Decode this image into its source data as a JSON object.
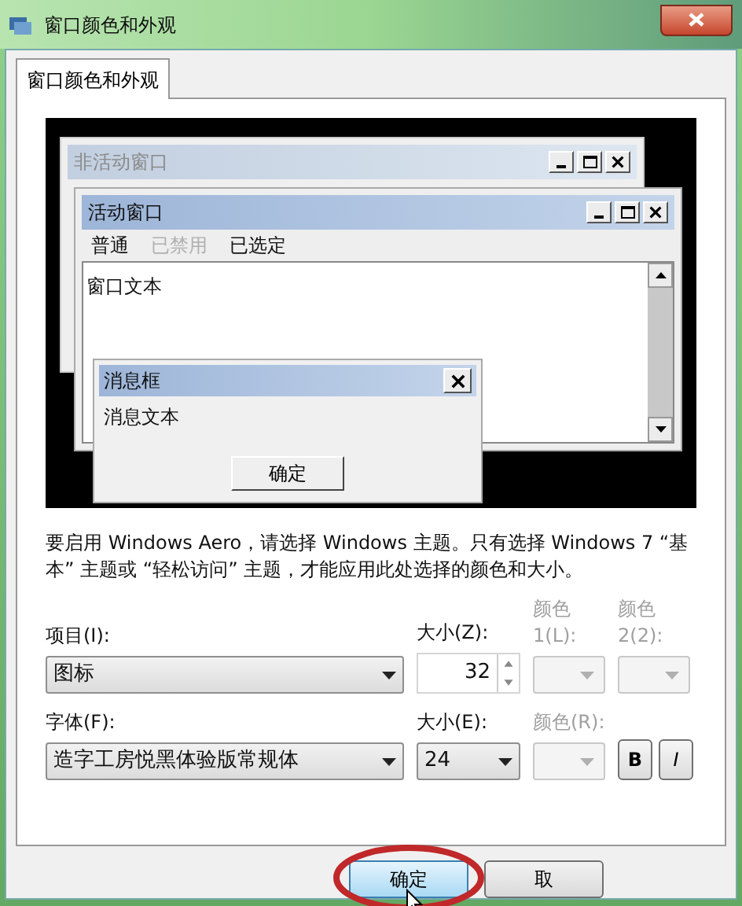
{
  "window": {
    "title": "窗口颜色和外观"
  },
  "tabs": [
    {
      "label": "窗口颜色和外观",
      "selected": true
    }
  ],
  "preview": {
    "inactive_window": {
      "title": "非活动窗口"
    },
    "active_window": {
      "title": "活动窗口",
      "menu": [
        {
          "label": "普通",
          "disabled": false
        },
        {
          "label": "已禁用",
          "disabled": true
        },
        {
          "label": "已选定",
          "disabled": false
        }
      ],
      "text": "窗口文本"
    },
    "message_box": {
      "title": "消息框",
      "text": "消息文本",
      "button": "确定"
    }
  },
  "description": "要启用 Windows Aero，请选择 Windows 主题。只有选择 Windows 7 “基本” 主题或 “轻松访问” 主题，才能应用此处选择的颜色和大小。",
  "rows": [
    {
      "fields": [
        {
          "kind": "dropdown",
          "label": "项目(I):",
          "value": "图标",
          "disabled": false
        },
        {
          "kind": "spinner",
          "label": "大小(Z):",
          "value": "32",
          "disabled": false
        },
        {
          "kind": "color",
          "label": "颜色 1(L):",
          "disabled": true
        },
        {
          "kind": "color",
          "label": "颜色 2(2):",
          "disabled": true
        }
      ]
    },
    {
      "fields": [
        {
          "kind": "dropdown",
          "label": "字体(F):",
          "value": "造字工房悦黑体验版常规体",
          "disabled": false
        },
        {
          "kind": "dropdown",
          "label": "大小(E):",
          "value": "24",
          "disabled": false
        },
        {
          "kind": "color",
          "label": "颜色(R):",
          "disabled": true
        },
        {
          "kind": "style",
          "buttons": [
            {
              "label": "B",
              "kind": "bold"
            },
            {
              "label": "I",
              "kind": "italic"
            }
          ]
        }
      ]
    }
  ],
  "buttons": [
    {
      "label": "确定",
      "highlighted": true
    },
    {
      "label": "取",
      "highlighted": false
    }
  ]
}
